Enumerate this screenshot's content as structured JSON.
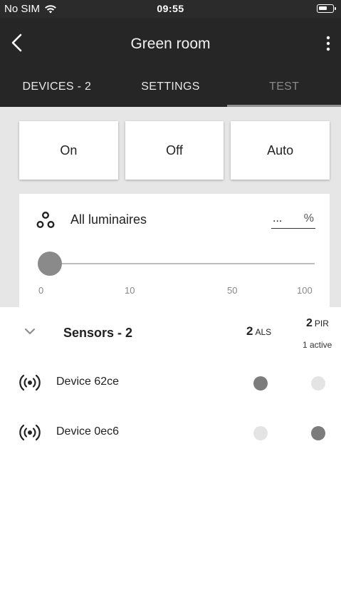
{
  "status_bar": {
    "carrier": "No SIM",
    "time": "09:55"
  },
  "header": {
    "title": "Green room"
  },
  "tabs": [
    {
      "label": "DEVICES - 2",
      "active": false
    },
    {
      "label": "SETTINGS",
      "active": false
    },
    {
      "label": "TEST",
      "active": true
    }
  ],
  "modes": {
    "on_label": "On",
    "off_label": "Off",
    "auto_label": "Auto"
  },
  "luminaires": {
    "label": "All luminaires",
    "value": "...",
    "unit": "%",
    "slider_value": 0,
    "ticks": [
      "0",
      "10",
      "50",
      "100"
    ]
  },
  "sensors": {
    "title": "Sensors - 2",
    "als_count": "2",
    "als_label": "ALS",
    "pir_count": "2",
    "pir_label": "PIR",
    "pir_active": "1 active",
    "devices": [
      {
        "name": "Device 62ce",
        "als": true,
        "pir": false
      },
      {
        "name": "Device 0ec6",
        "als": false,
        "pir": true
      }
    ]
  },
  "colors": {
    "header_bg": "#262626",
    "panel_bg": "#e6e6e6",
    "indicator_on": "#7c7c7c",
    "indicator_off": "#e4e4e4"
  },
  "icons": [
    "wifi-icon",
    "battery-icon",
    "back-icon",
    "more-vert-icon",
    "luminaires-icon",
    "chevron-down-icon",
    "sensor-icon"
  ]
}
